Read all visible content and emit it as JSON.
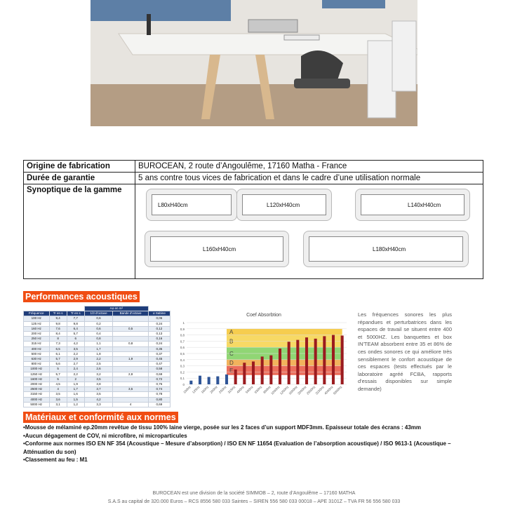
{
  "table": {
    "rows": [
      {
        "label": "Origine de fabrication",
        "value": "BUROCEAN, 2 route d’Angoulême, 17160 Matha - France"
      },
      {
        "label": "Durée de garantie",
        "value": "5 ans contre tous vices de fabrication et dans le cadre d’une utilisation normale"
      },
      {
        "label": "Synoptique de la gamme",
        "value": ""
      }
    ],
    "benches": [
      "L80xH40cm",
      "L120xH40cm",
      "L140xH40cm",
      "L160xH40cm",
      "L180xH40cm"
    ]
  },
  "acoustics": {
    "title": "Performances acoustiques",
    "table": {
      "group_header": "Aα en m²",
      "headers": [
        "Fréquence",
        "Tr en s",
        "Tr en s",
        "1/3 d'octave",
        "Bande d'octave",
        "α Sabine"
      ],
      "rows": [
        [
          "100 Hz",
          "9,4",
          "7,7",
          "0,6",
          "",
          "0,06"
        ],
        [
          "125 Hz",
          "9,8",
          "9,8",
          "0,2",
          "",
          "0,24"
        ],
        [
          "160 Hz",
          "7,6",
          "6,4",
          "0,6",
          "0,5",
          "0,12"
        ],
        [
          "200 Hz",
          "8,4",
          "5,7",
          "0,4",
          "",
          "0,13"
        ],
        [
          "250 Hz",
          "8",
          "6",
          "0,8",
          "",
          "0,16"
        ],
        [
          "315 Hz",
          "7,3",
          "4,2",
          "1,1",
          "0,8",
          "0,24"
        ],
        [
          "400 Hz",
          "6,5",
          "3,5",
          "1,7",
          "",
          "0,35"
        ],
        [
          "500 Hz",
          "6,1",
          "2,2",
          "1,8",
          "",
          "0,37"
        ],
        [
          "630 Hz",
          "5,7",
          "2,9",
          "2,2",
          "1,9",
          "0,45"
        ],
        [
          "800 Hz",
          "5,6",
          "2,7",
          "2,5",
          "",
          "0,47"
        ],
        [
          "1000 Hz",
          "5",
          "2,4",
          "2,6",
          "",
          "0,58"
        ],
        [
          "1250 Hz",
          "5,7",
          "2,2",
          "3,2",
          "2,8",
          "0,69"
        ],
        [
          "1600 Hz",
          "5",
          "2",
          "3,5",
          "",
          "0,72"
        ],
        [
          "2000 Hz",
          "4,5",
          "1,9",
          "3,8",
          "",
          "0,76"
        ],
        [
          "2500 Hz",
          "4",
          "1,7",
          "3,7",
          "3,5",
          "0,74"
        ],
        [
          "3150 Hz",
          "3,5",
          "1,6",
          "3,5",
          "",
          "0,78"
        ],
        [
          "4000 Hz",
          "3,6",
          "1,5",
          "4,2",
          "",
          "0,80"
        ],
        [
          "5000 Hz",
          "3,1",
          "1,2",
          "3,3",
          "4",
          "0,69"
        ]
      ]
    },
    "description": "Les fréquences sonores les plus répandues et perturbatrices dans les espaces de travail se situent entre 400 et 5000HZ. Les banquettes et box IN'TEAM absorbent entre 35 et 86% de ces ondes sonores ce qui améliore très sensiblement le confort acoustique de ces espaces (tests effectués par le laboratoire agréé FCBA, rapports d'essais disponibles sur simple demande)"
  },
  "chart_data": {
    "type": "bar",
    "title": "Coef Absorbtion",
    "categories": [
      "100Hz",
      "125Hz",
      "160Hz",
      "200Hz",
      "250Hz",
      "315Hz",
      "400Hz",
      "500Hz",
      "630Hz",
      "800Hz",
      "1000Hz",
      "1250Hz",
      "1600Hz",
      "2000Hz",
      "2500Hz",
      "3150Hz",
      "4000Hz",
      "5000Hz"
    ],
    "values": [
      0.06,
      0.14,
      0.12,
      0.13,
      0.16,
      0.24,
      0.35,
      0.37,
      0.45,
      0.47,
      0.58,
      0.69,
      0.72,
      0.76,
      0.74,
      0.78,
      0.8,
      0.79
    ],
    "ylim": [
      0,
      1
    ],
    "yticks": [
      "0",
      "0,1",
      "0,2",
      "0,3",
      "0,4",
      "0,5",
      "0,6",
      "0,7",
      "0,8",
      "0,9",
      "1"
    ],
    "grid": true,
    "bands": [
      {
        "label": "A",
        "color": "#f4c430"
      },
      {
        "label": "B",
        "color": "#f6d24a"
      },
      {
        "label": "C",
        "color": "#7ccf5c"
      },
      {
        "label": "D",
        "color": "#f0a640"
      },
      {
        "label": "E",
        "color": "#e9553f"
      }
    ],
    "bar_color": "#9a1b1f"
  },
  "materials": {
    "title": "Matériaux et conformité aux normes",
    "bullets": [
      "•Mousse de mélaminé ep.20mm revêtue de tissu 100% laine vierge, posée sur les 2 faces d’un support MDF3mm. Epaisseur totale des écrans : 43mm",
      "•Aucun dégagement de COV, ni microfibre, ni microparticules",
      "•Conforme aux normes ISO EN NF 354 (Acoustique – Mesure d’absorption) / ISO EN NF 11654 (Evaluation de l’absorption acoustique) / ISO 9613-1 (Acoustique – Atténuation du son)",
      "•Classement au feu : M1"
    ]
  },
  "footer": {
    "line1": "BUROCEAN est une division de la société SIMMOB – 2, route d’Angoulême – 17160 MATHA",
    "line2": "S.A.S au capital de 320.000 Euros – RCS 8556 580 033 Saintes – SIREN 556 580 033 00018 – APE 3101Z – TVA FR 56 556 580 033"
  }
}
